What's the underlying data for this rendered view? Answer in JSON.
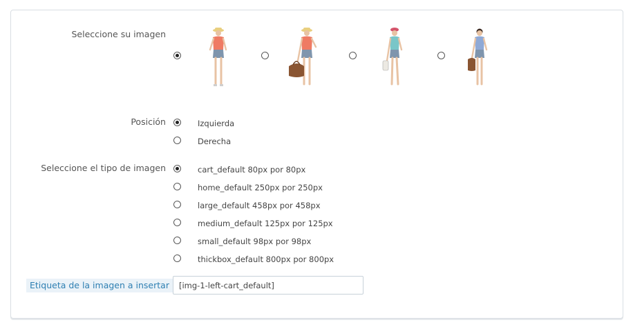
{
  "form": {
    "image_label": "Seleccione su imagen",
    "images": [
      {
        "name": "model-coral-top-hat",
        "checked": true
      },
      {
        "name": "model-coral-top-bag",
        "checked": false
      },
      {
        "name": "model-teal-top",
        "checked": false
      },
      {
        "name": "model-blue-top-bag",
        "checked": false
      }
    ],
    "position_label": "Posición",
    "positions": [
      {
        "label": "Izquierda",
        "checked": true
      },
      {
        "label": "Derecha",
        "checked": false
      }
    ],
    "type_label": "Seleccione el tipo de imagen",
    "types": [
      {
        "label": "cart_default 80px por 80px",
        "checked": true
      },
      {
        "label": "home_default 250px por 250px",
        "checked": false
      },
      {
        "label": "large_default 458px por 458px",
        "checked": false
      },
      {
        "label": "medium_default 125px por 125px",
        "checked": false
      },
      {
        "label": "small_default 98px por 98px",
        "checked": false
      },
      {
        "label": "thickbox_default 800px por 800px",
        "checked": false
      }
    ],
    "tag_label": "Etiqueta de la imagen a insertar",
    "tag_value": "[img-1-left-cart_default]"
  },
  "colors": {
    "accent_label_bg": "#eaf2f8",
    "accent_label_text": "#2e7fb2",
    "skin": "#e8c3a4",
    "coral_top": "#ef7b63",
    "teal_top": "#79c6c8",
    "blue_top": "#8fa9d6",
    "denim": "#7f95ad",
    "bag": "#8a5532",
    "hat": "#e9cf7f"
  }
}
